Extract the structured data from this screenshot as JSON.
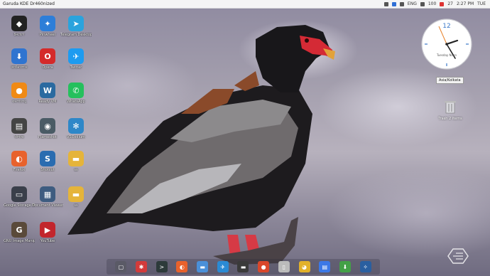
{
  "top_panel": {
    "window_title": "Garuda KDE Dr460nized",
    "tray_items": [
      "ENG",
      "100",
      "27"
    ],
    "time": "2:27 PM",
    "date": "TUE"
  },
  "desktop_icons": [
    {
      "label": "ইনস্কেপ",
      "color": "#222222",
      "glyph": "◆"
    },
    {
      "label": "Pinwheel",
      "color": "#2d7ed8",
      "glyph": "✦"
    },
    {
      "label": "Telegram Desktop",
      "color": "#2aa3dd",
      "glyph": "➤"
    },
    {
      "label": "ডাউনলোড",
      "color": "#2f74d0",
      "glyph": "⬇"
    },
    {
      "label": "Opera",
      "color": "#d42a2a",
      "glyph": "O"
    },
    {
      "label": "Twitter",
      "color": "#1d9bf0",
      "glyph": "✈"
    },
    {
      "label": "কমলালেবু",
      "color": "#f08a15",
      "glyph": "●"
    },
    {
      "label": "Ready VM",
      "color": "#2a6aa0",
      "glyph": "W"
    },
    {
      "label": "WhatsApp",
      "color": "#25c05d",
      "glyph": "✆"
    },
    {
      "label": "প্রিন্টার",
      "color": "#444444",
      "glyph": "▤"
    },
    {
      "label": "Flameshot",
      "color": "#4a5b65",
      "glyph": "◉"
    },
    {
      "label": "VSCodium",
      "color": "#2e87c8",
      "glyph": "✻"
    },
    {
      "label": "Firefox",
      "color": "#e8622c",
      "glyph": "◐"
    },
    {
      "label": "Shotcut",
      "color": "#2a6cb0",
      "glyph": "S"
    },
    {
      "label": "ss",
      "color": "#e5b43a",
      "glyph": "▬"
    },
    {
      "label": "Google Storage Manager",
      "color": "#3a3f4a",
      "glyph": "▭"
    },
    {
      "label": "Document Viewer",
      "color": "#3e5c80",
      "glyph": "▦"
    },
    {
      "label": "ss",
      "color": "#e5b43a",
      "glyph": "▬"
    },
    {
      "label": "GNU Image Manipulation Pr.",
      "color": "#5a4a3a",
      "glyph": "G"
    },
    {
      "label": "YouTube",
      "color": "#c2262d",
      "glyph": "▶"
    }
  ],
  "clock": {
    "twelve": "12",
    "caption": "Tuesday Noon",
    "tag": "Asia/Kolkata"
  },
  "trash": {
    "label": "Trash 2 items"
  },
  "dock": [
    {
      "name": "show-desktop",
      "color": "#5a5a66",
      "glyph": "▢"
    },
    {
      "name": "app-bug",
      "color": "#d23b3b",
      "glyph": "✱"
    },
    {
      "name": "terminal",
      "color": "#2d3a3a",
      "glyph": ">"
    },
    {
      "name": "firefox",
      "color": "#e8622c",
      "glyph": "◐"
    },
    {
      "name": "files",
      "color": "#4a90d9",
      "glyph": "▬"
    },
    {
      "name": "app-bird",
      "color": "#2a8ad4",
      "glyph": "✈"
    },
    {
      "name": "app-dark",
      "color": "#3a3a3a",
      "glyph": "▬"
    },
    {
      "name": "app-red",
      "color": "#d9472b",
      "glyph": "●"
    },
    {
      "name": "app-gray",
      "color": "#bbbbbb",
      "glyph": "▯"
    },
    {
      "name": "chrome",
      "color": "#e2b12a",
      "glyph": "◕"
    },
    {
      "name": "docs",
      "color": "#3b78e7",
      "glyph": "▤"
    },
    {
      "name": "download",
      "color": "#43a047",
      "glyph": "⬇"
    },
    {
      "name": "app-blue",
      "color": "#2a5fa0",
      "glyph": "✧"
    }
  ]
}
